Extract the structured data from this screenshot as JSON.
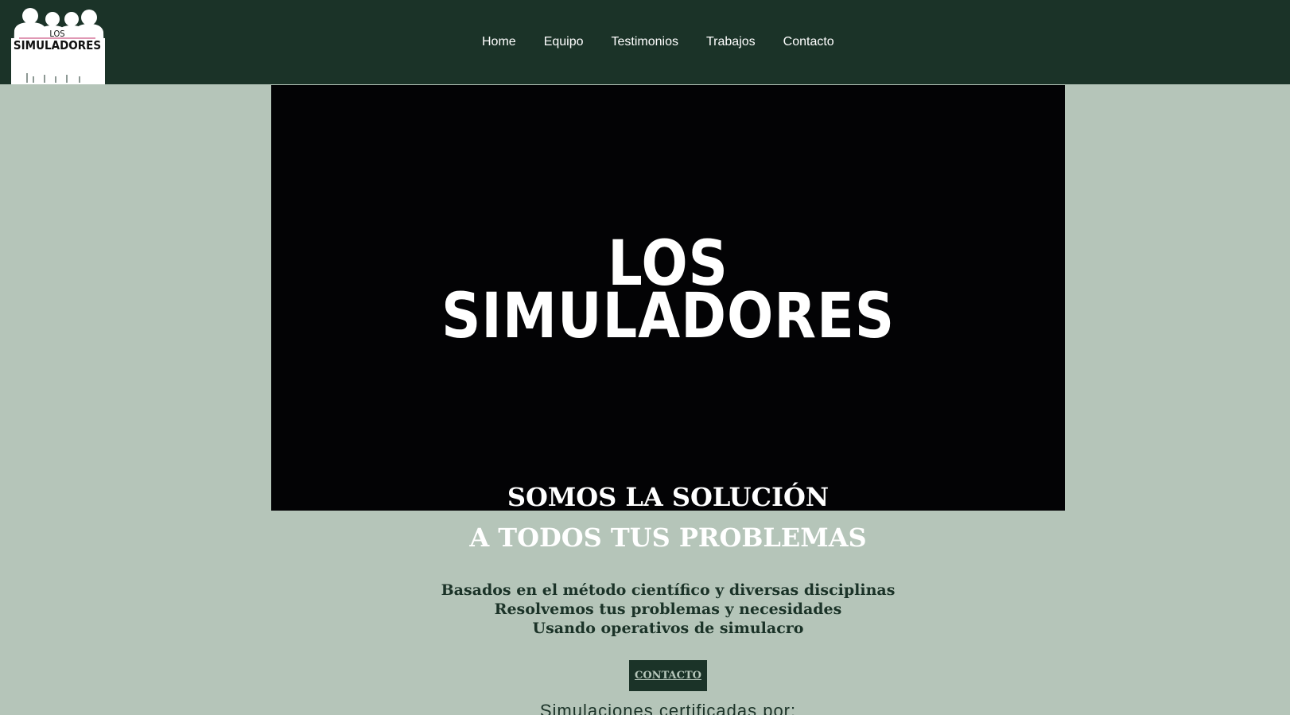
{
  "header": {
    "logo": {
      "line1": "LOS",
      "line2": "SIMULADORES"
    },
    "nav": [
      "Home",
      "Equipo",
      "Testimonios",
      "Trabajos",
      "Contacto"
    ]
  },
  "hero": {
    "video_title_line1": "LOS",
    "video_title_line2": "SIMULADORES",
    "headline_line1": "SOMOS LA SOLUCIÓN",
    "headline_line2": "A TODOS TUS PROBLEMAS",
    "description": [
      "Basados en el método científico y diversas disciplinas",
      "Resolvemos tus problemas y necesidades",
      "Usando operativos de simulacro"
    ],
    "cta_label": "CONTACTO",
    "certified_text": "Simulaciones certificadas por:"
  },
  "colors": {
    "header_bg": "#1b3328",
    "page_bg": "#b5c5b9",
    "video_bg": "#030305",
    "text_dark": "#1b3328"
  }
}
